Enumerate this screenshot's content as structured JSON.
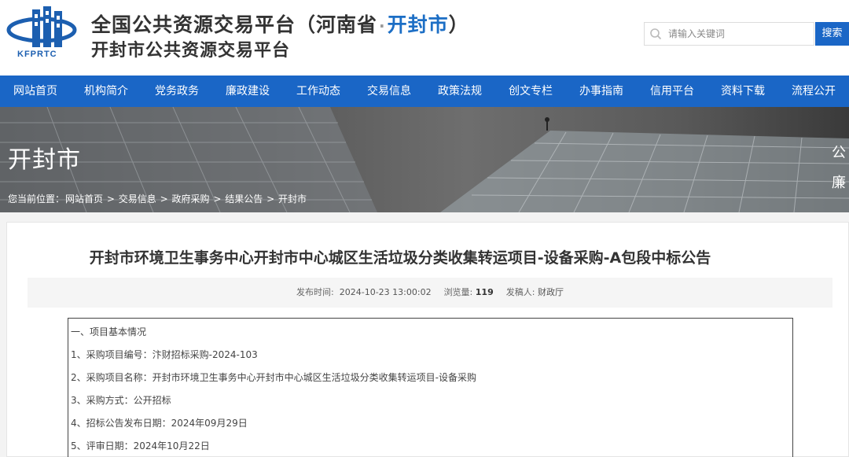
{
  "header": {
    "logo_text": "KFPRTC",
    "title_main": "全国公共资源交易平台（河南省",
    "title_dot": "·",
    "title_city": "开封市",
    "title_close": "）",
    "subtitle": "开封市公共资源交易平台",
    "search_placeholder": "请输入关键词",
    "search_button": "搜索"
  },
  "nav": {
    "items": [
      "网站首页",
      "机构简介",
      "党务政务",
      "廉政建设",
      "工作动态",
      "交易信息",
      "政策法规",
      "创文专栏",
      "办事指南",
      "信用平台",
      "资料下载",
      "流程公开"
    ]
  },
  "banner": {
    "title": "开封市",
    "breadcrumb": [
      "您当前位置：",
      "网站首页",
      ">",
      "交易信息",
      ">",
      "政府采购",
      ">",
      "结果公告",
      ">",
      "开封市"
    ],
    "side_tab": [
      "公",
      "廉"
    ]
  },
  "article": {
    "title": "开封市环境卫生事务中心开封市中心城区生活垃圾分类收集转运项目-设备采购-A包段中标公告",
    "publish_label": "发布时间:",
    "publish_time": "2024-10-23 13:00:02",
    "views_label": "浏览量:",
    "views": "119",
    "author_label": "发稿人:",
    "author": "财政厅",
    "lines": [
      "一、项目基本情况",
      "1、采购项目编号：汴财招标采购-2024-103",
      "2、采购项目名称：开封市环境卫生事务中心开封市中心城区生活垃圾分类收集转运项目-设备采购",
      "3、采购方式：公开招标",
      "4、招标公告发布日期：2024年09月29日",
      "5、评审日期：2024年10月22日"
    ]
  },
  "colors": {
    "brand_blue": "#1a66c6",
    "city_blue": "#1c6ec5"
  }
}
